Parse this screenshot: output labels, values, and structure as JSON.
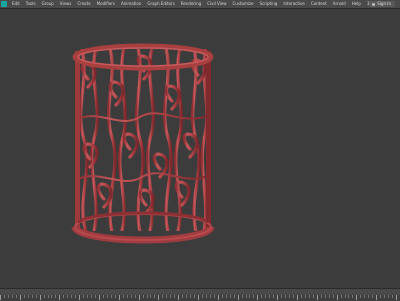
{
  "window": {
    "title_bar_color": "#e9e9e9"
  },
  "menubar": {
    "items": [
      "Edit",
      "Tools",
      "Group",
      "Views",
      "Create",
      "Modifiers",
      "Animation",
      "Graph Editors",
      "Rendering",
      "Civil View",
      "Customize",
      "Scripting",
      "Interactive",
      "Content",
      "Arnold",
      "Help",
      "3DEXCONNEX"
    ],
    "signin_label": "Sign In",
    "icon": "app-logo-icon"
  },
  "viewport": {
    "background": "#3c3c3c",
    "object": "red lattice cylinder lamp shade",
    "object_color": "#b5474a"
  },
  "timeline": {
    "background": "#4a4a4a"
  }
}
